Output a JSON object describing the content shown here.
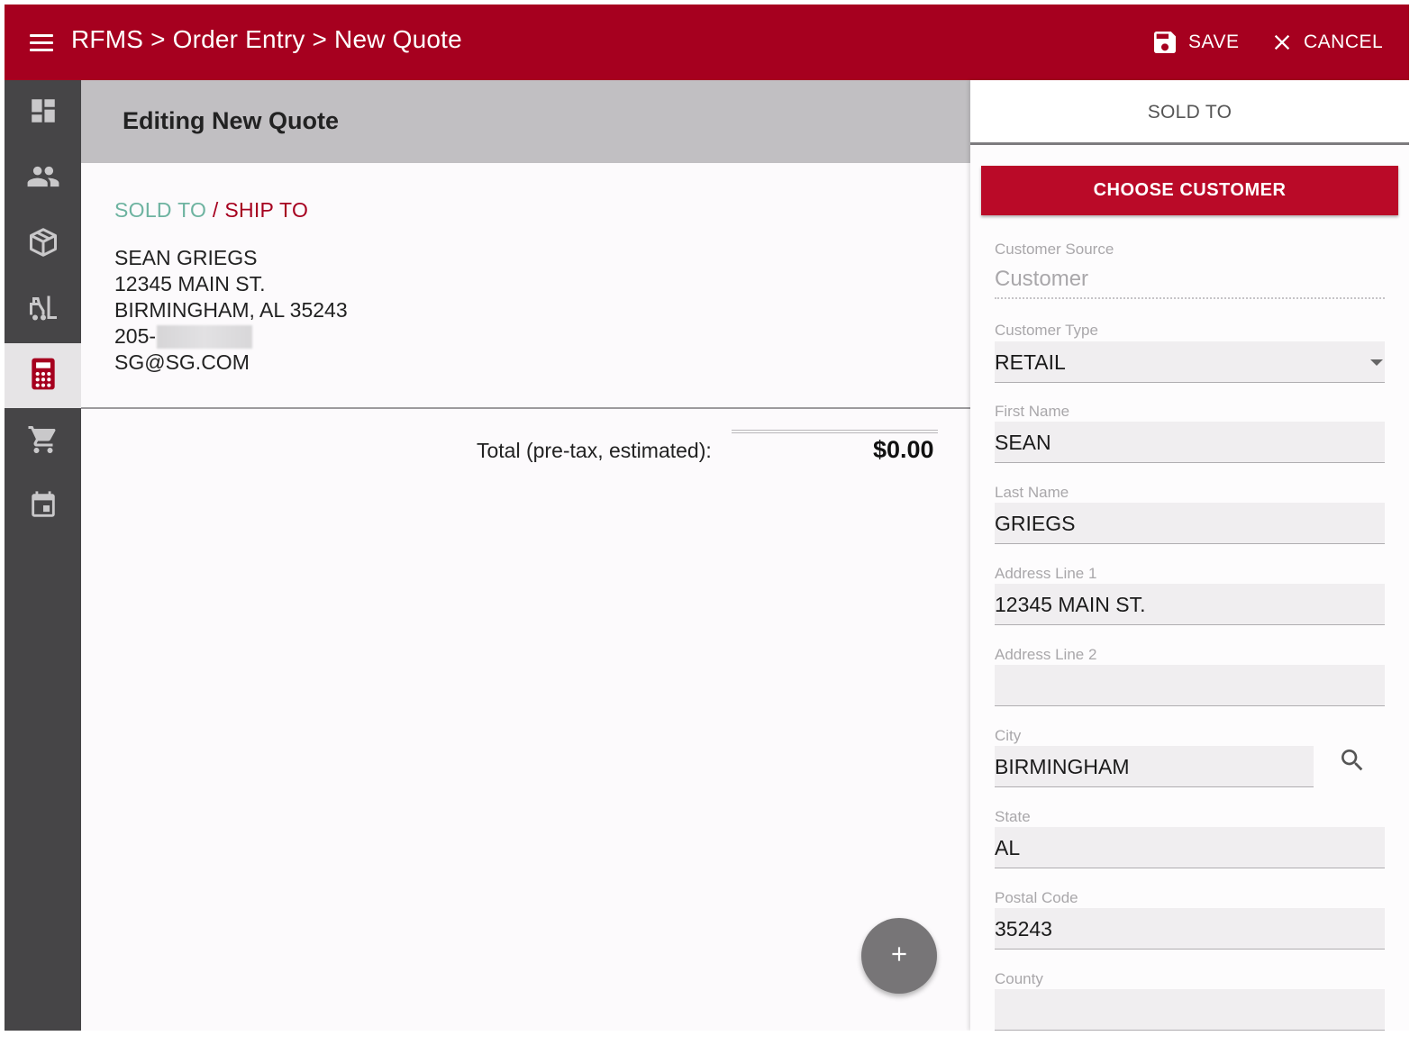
{
  "header": {
    "breadcrumb": "RFMS > Order Entry > New Quote",
    "save_label": "SAVE",
    "cancel_label": "CANCEL"
  },
  "nav": {
    "items": [
      {
        "icon": "dashboard-icon",
        "active": false
      },
      {
        "icon": "people-icon",
        "active": false
      },
      {
        "icon": "package-icon",
        "active": false
      },
      {
        "icon": "forklift-icon",
        "active": false
      },
      {
        "icon": "calculator-icon",
        "active": true
      },
      {
        "icon": "shopping-cart-icon",
        "active": false
      },
      {
        "icon": "calendar-icon",
        "active": false
      }
    ]
  },
  "main": {
    "title": "Editing New Quote",
    "sold_to_label": "SOLD TO",
    "slash": " / ",
    "ship_to_label": "SHIP TO",
    "customer": {
      "name": "SEAN GRIEGS",
      "address1": "12345 MAIN ST.",
      "city_state_zip": "BIRMINGHAM, AL 35243",
      "phone_prefix": "205-",
      "email": "SG@SG.COM"
    },
    "total_label": "Total (pre-tax, estimated):",
    "total_value": "$0.00"
  },
  "panel": {
    "title": "SOLD TO",
    "choose_button": "CHOOSE CUSTOMER",
    "fields": {
      "customer_source": {
        "label": "Customer Source",
        "value": "Customer"
      },
      "customer_type": {
        "label": "Customer Type",
        "value": "RETAIL"
      },
      "first_name": {
        "label": "First Name",
        "value": "SEAN"
      },
      "last_name": {
        "label": "Last Name",
        "value": "GRIEGS"
      },
      "address1": {
        "label": "Address Line 1",
        "value": "12345 MAIN ST."
      },
      "address2": {
        "label": "Address Line 2",
        "value": ""
      },
      "city": {
        "label": "City",
        "value": "BIRMINGHAM"
      },
      "state": {
        "label": "State",
        "value": "AL"
      },
      "postal_code": {
        "label": "Postal Code",
        "value": "35243"
      },
      "county": {
        "label": "County",
        "value": ""
      }
    }
  },
  "colors": {
    "brand": "#a6001f",
    "button": "#ba0a28",
    "sold_to": "#6db3a0",
    "nav_bg": "#464547"
  }
}
